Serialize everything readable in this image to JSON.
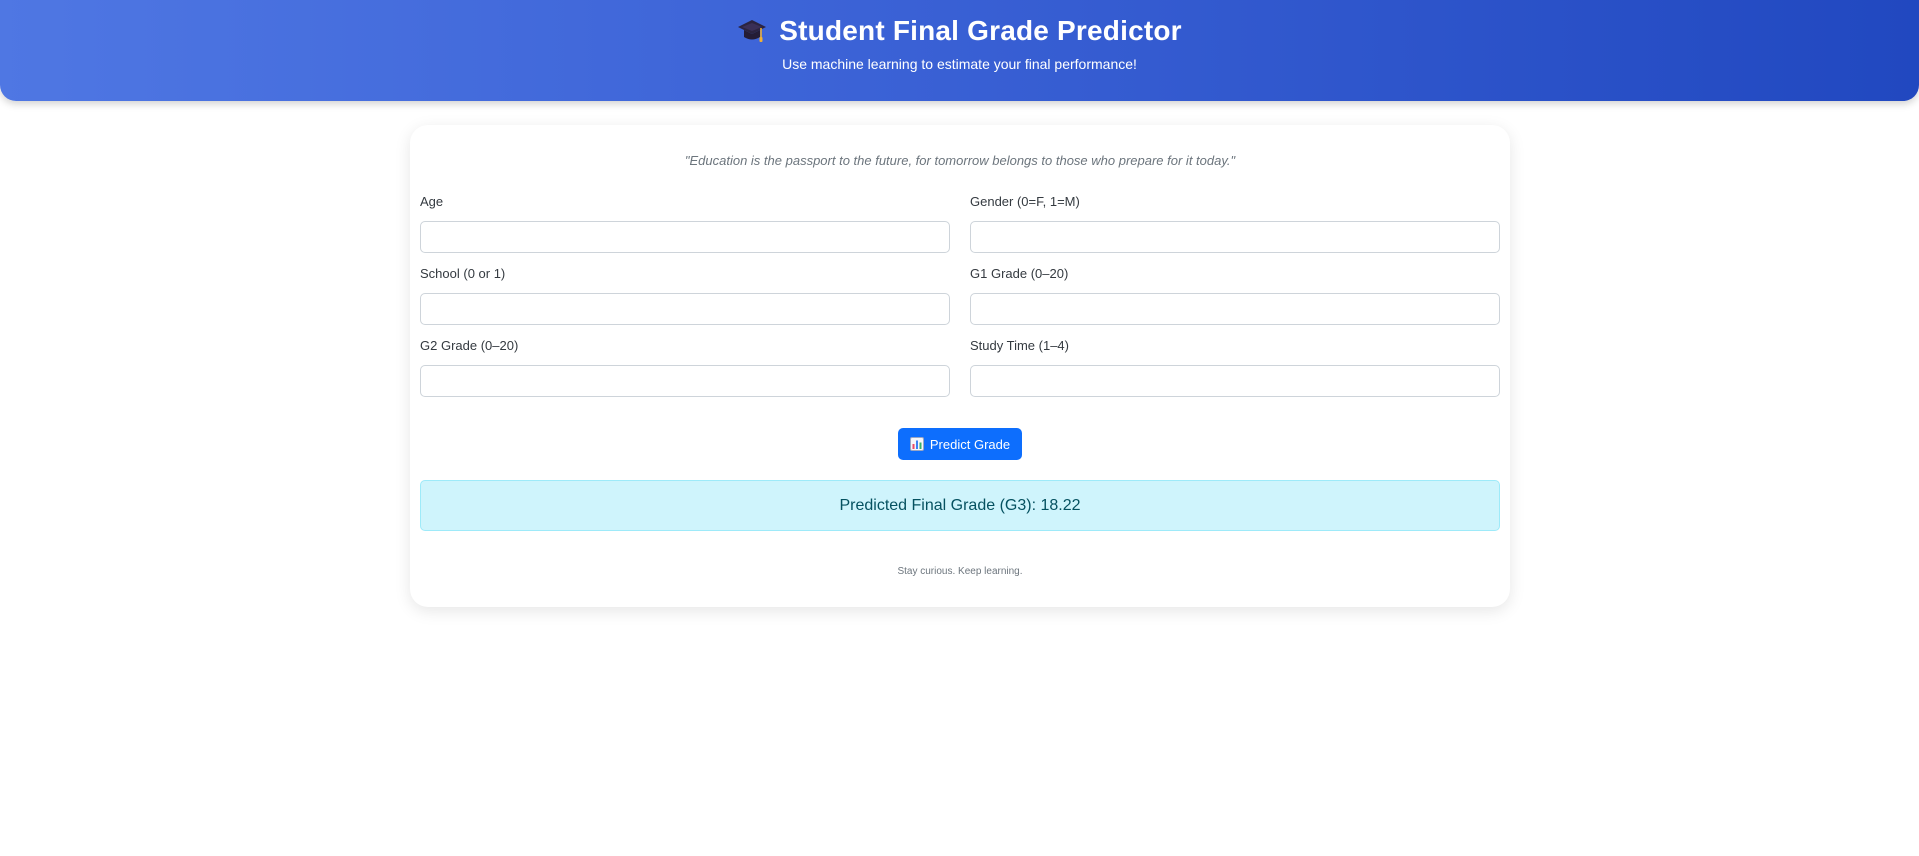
{
  "header": {
    "icon": "graduation-cap-icon",
    "title": "Student Final Grade Predictor",
    "subtitle": "Use machine learning to estimate your final performance!"
  },
  "form": {
    "quote": "\"Education is the passport to the future, for tomorrow belongs to those who prepare for it today.\"",
    "fields": [
      {
        "label": "Age",
        "value": "",
        "placeholder": ""
      },
      {
        "label": "Gender (0=F, 1=M)",
        "value": "",
        "placeholder": ""
      },
      {
        "label": "School (0 or 1)",
        "value": "",
        "placeholder": ""
      },
      {
        "label": "G1 Grade (0–20)",
        "value": "",
        "placeholder": ""
      },
      {
        "label": "G2 Grade (0–20)",
        "value": "",
        "placeholder": ""
      },
      {
        "label": "Study Time (1–4)",
        "value": "",
        "placeholder": ""
      }
    ],
    "button": {
      "icon": "bar-chart-icon",
      "label": "Predict Grade"
    }
  },
  "result": {
    "text": "Predicted Final Grade (G3): 18.22"
  },
  "footer": {
    "text": "Stay curious. Keep learning."
  },
  "colors": {
    "header_gradient_start": "#4f77e3",
    "header_gradient_end": "#2148c0",
    "button": "#0d6efd",
    "result_background": "#cff4fc",
    "result_text": "#055160"
  }
}
